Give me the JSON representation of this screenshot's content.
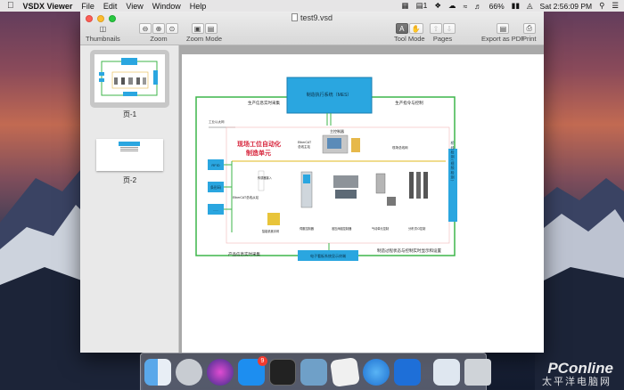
{
  "menubar": {
    "app_name": "VSDX Viewer",
    "items": [
      "File",
      "Edit",
      "View",
      "Window",
      "Help"
    ],
    "notification_count": "1",
    "battery": "66%",
    "clock": "Sat 2:56:09 PM"
  },
  "window": {
    "title": "test9.vsd",
    "toolbar": {
      "thumbnails_label": "Thumbnails",
      "zoom_label": "Zoom",
      "zoom_mode_label": "Zoom Mode",
      "tool_mode_label": "Tool Mode",
      "pages_label": "Pages",
      "export_label": "Export as PDF",
      "print_label": "Print"
    }
  },
  "sidebar": {
    "pages": [
      {
        "label": "页-1",
        "selected": true
      },
      {
        "label": "页-2",
        "selected": false
      }
    ]
  },
  "diagram": {
    "top_box": "制造执行系统（MES）",
    "top_left_caption": "生产信息实时采集",
    "top_right_caption": "生产指令与控制",
    "ethernet_label": "工业以太网",
    "title_line1": "现场工位自动化",
    "title_line2": "制造单元",
    "left_boxes": [
      "RFID",
      "条形码",
      "......"
    ],
    "right_box": "桥 线 检 测 ( 视 频 检 测 )",
    "controller_label": "主控制器",
    "ethercat_bus_1": "EtherCAT",
    "ethercat_bus_2": "总线主站",
    "ethercat_mid": "EtherCAT总线从站",
    "field_bus_label": "现场总线网",
    "component_labels": [
      "传感器接入",
      "智能机械手臂",
      "伺服控制器",
      "液压阀组控制器",
      "气动单元控制",
      "分布式IO控制"
    ],
    "bottom_box": "电子看板系统显示终端",
    "bottom_left_caption": "产品信息实时采集",
    "bottom_right_caption": "制造过程状态与控制实时显示和设置"
  },
  "watermark": {
    "brand": "PConline",
    "sub": "太平洋电脑网"
  },
  "colors": {
    "accent_blue": "#2aa6e0",
    "line_green": "#3db54a",
    "title_red": "#d7263d"
  }
}
